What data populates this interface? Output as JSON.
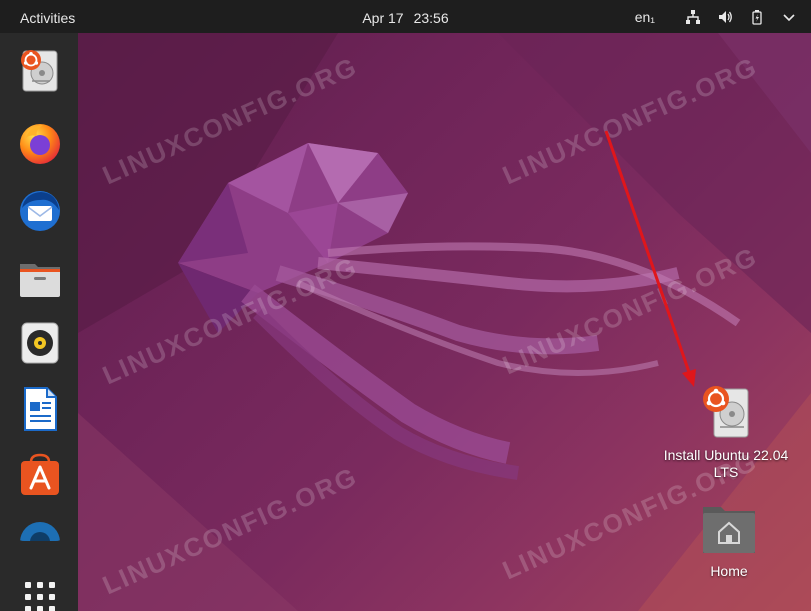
{
  "topbar": {
    "activities_label": "Activities",
    "date": "Apr 17",
    "time": "23:56",
    "language": "en₁",
    "icons": [
      "network-icon",
      "volume-icon",
      "battery-icon"
    ]
  },
  "dock": {
    "items": [
      {
        "name": "ubuntu-installer",
        "icon": "installer-icon"
      },
      {
        "name": "firefox",
        "icon": "firefox-icon"
      },
      {
        "name": "thunderbird",
        "icon": "thunderbird-icon"
      },
      {
        "name": "files",
        "icon": "files-icon"
      },
      {
        "name": "rhythmbox",
        "icon": "rhythmbox-icon"
      },
      {
        "name": "libreoffice-writer",
        "icon": "writer-icon"
      },
      {
        "name": "ubuntu-software",
        "icon": "software-icon"
      },
      {
        "name": "help",
        "icon": "help-icon"
      }
    ],
    "show_apps_icon": "grid-icon"
  },
  "desktop": {
    "icons": [
      {
        "label_line1": "Install Ubuntu 22.04",
        "label_line2": "LTS",
        "icon": "installer-icon"
      },
      {
        "label_line1": "Home",
        "icon": "home-folder-icon"
      }
    ],
    "watermark_text": "LINUXCONFIG.ORG",
    "colors": {
      "accent": "#e95420",
      "annotation_arrow": "#e0161b"
    }
  }
}
